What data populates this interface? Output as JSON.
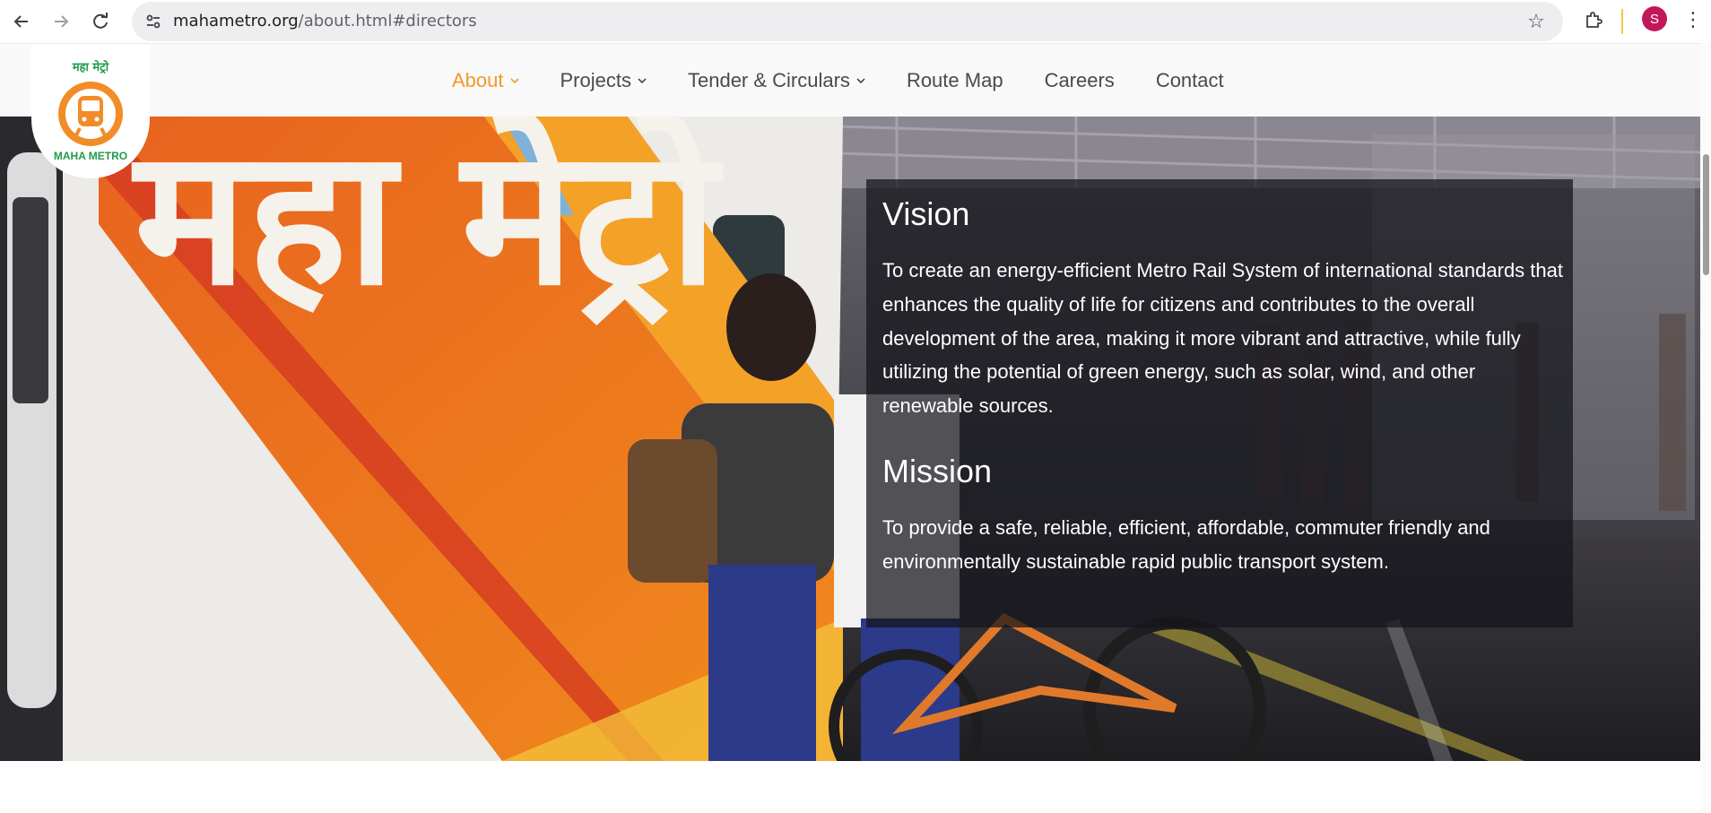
{
  "browser": {
    "url_host": "mahametro.org",
    "url_path": "/about.html#directors",
    "profile_initial": "S"
  },
  "logo": {
    "hindi_text": "महा मेट्रो",
    "name": "MAHA METRO"
  },
  "nav": {
    "items": [
      {
        "label": "About",
        "has_dropdown": true,
        "active": true
      },
      {
        "label": "Projects",
        "has_dropdown": true,
        "active": false
      },
      {
        "label": "Tender & Circulars",
        "has_dropdown": true,
        "active": false
      },
      {
        "label": "Route Map",
        "has_dropdown": false,
        "active": false
      },
      {
        "label": "Careers",
        "has_dropdown": false,
        "active": false
      },
      {
        "label": "Contact",
        "has_dropdown": false,
        "active": false
      }
    ]
  },
  "hero": {
    "vision_title": "Vision",
    "vision_text": "To create an energy-efficient Metro Rail System of international standards that enhances the quality of life for citizens and contributes to the overall development of the area, making it more vibrant and attractive, while fully utilizing the potential of green energy, such as solar, wind, and other renewable sources.",
    "mission_title": "Mission",
    "mission_text": "To provide a safe, reliable, efficient, affordable, commuter friendly and environmentally sustainable rapid public transport system.",
    "train_text": "महा मेट्रो"
  },
  "colors": {
    "accent": "#f19a2a",
    "brand_green": "#1f9a4b",
    "text": "#4a4a4a"
  }
}
